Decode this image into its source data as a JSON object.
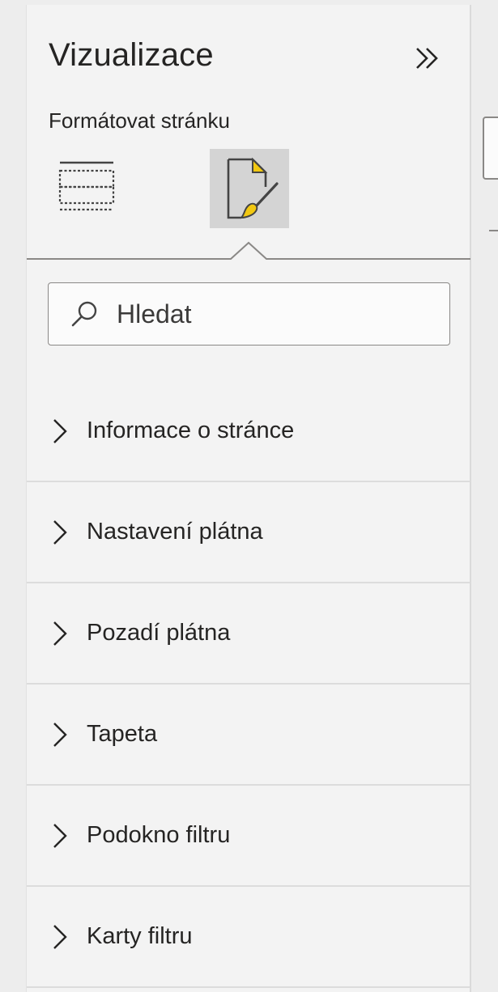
{
  "pane": {
    "title": "Vizualizace",
    "subtitle": "Formátovat stránku",
    "collapse_icon": "double-chevron-right-icon"
  },
  "tabs": [
    {
      "name": "build-visual",
      "icon": "dashed-grid-icon",
      "selected": false
    },
    {
      "name": "format-page",
      "icon": "page-paintbrush-icon",
      "selected": true
    }
  ],
  "search": {
    "placeholder": "Hledat",
    "value": ""
  },
  "sections": [
    {
      "label": "Informace o stránce"
    },
    {
      "label": "Nastavení plátna"
    },
    {
      "label": "Pozadí plátna"
    },
    {
      "label": "Tapeta"
    },
    {
      "label": "Podokno filtru"
    },
    {
      "label": "Karty filtru"
    }
  ],
  "colors": {
    "accent_yellow": "#f2c811",
    "selected_tab_bg": "#d4d4d4",
    "text": "#252423"
  }
}
